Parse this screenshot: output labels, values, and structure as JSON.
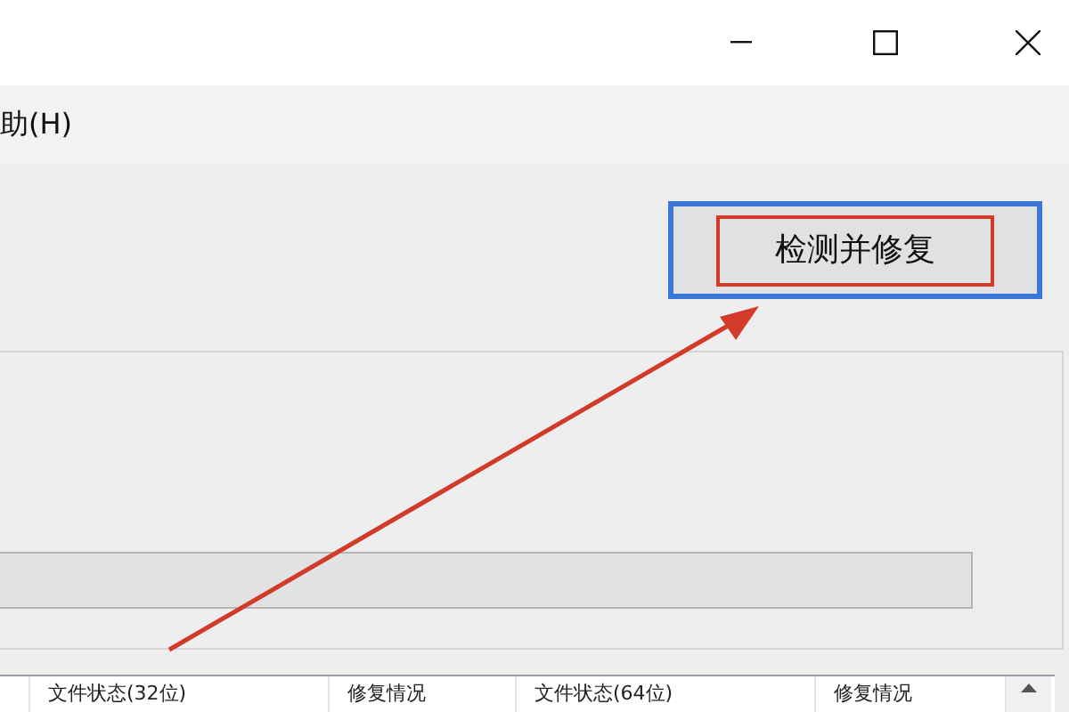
{
  "menu_bar": {
    "items": [
      {
        "label": "助(H)"
      }
    ]
  },
  "repair_button": {
    "label": "检测并修复"
  },
  "progress": {
    "level": 0
  },
  "table": {
    "columns": [
      "文件状态(32位)",
      "修复情况",
      "文件状态(64位)",
      "修复情况"
    ]
  }
}
